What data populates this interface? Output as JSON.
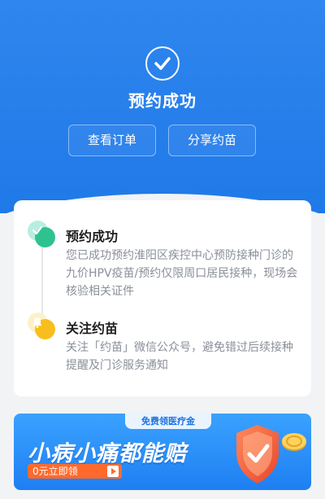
{
  "hero": {
    "title": "预约成功",
    "buttons": {
      "view_order": "查看订单",
      "share": "分享约苗"
    }
  },
  "steps": [
    {
      "title": "预约成功",
      "desc": "您已成功预约淮阳区疾控中心预防接种门诊的九价HPV疫苗/预约仅限周口居民接种，现场会核验相关证件",
      "icon": "check-icon",
      "color_back": "#b7eee0",
      "color_front": "#2ec28f"
    },
    {
      "title": "关注约苗",
      "desc": "关注「约苗」微信公众号，避免错过后续接种提醒及门诊服务通知",
      "icon": "bell-icon",
      "color_back": "#fdf1c8",
      "color_front": "#f7be1d"
    }
  ],
  "banner": {
    "badge": "免费领医疗金",
    "title": "小病小痛都能赔",
    "cta": "0元立即领"
  },
  "colors": {
    "primary": "#2f86ee",
    "card_bg": "#ffffff",
    "page_bg": "#f2f3f5",
    "cta": "#ff6a2c"
  }
}
